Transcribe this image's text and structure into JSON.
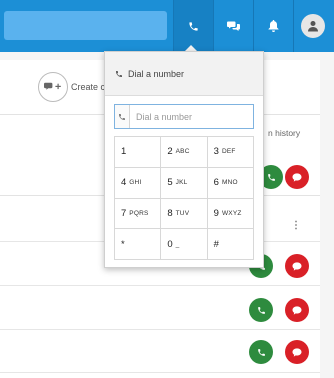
{
  "topbar": {
    "icons": [
      "phone-icon",
      "chat-icon",
      "bell-icon",
      "user-icon"
    ],
    "colors": {
      "bar": "#1c8fd6",
      "active": "#1781c4",
      "search": "#5ab2ee"
    }
  },
  "background_panel": {
    "create_label": "Create c",
    "history_label": "n history",
    "more_symbol": "⋮"
  },
  "dialpad": {
    "title": "Dial a number",
    "input_value": "",
    "input_placeholder": "Dial a number",
    "keys": [
      {
        "digit": "1",
        "letters": ""
      },
      {
        "digit": "2",
        "letters": "ABC"
      },
      {
        "digit": "3",
        "letters": "DEF"
      },
      {
        "digit": "4",
        "letters": "GHI"
      },
      {
        "digit": "5",
        "letters": "JKL"
      },
      {
        "digit": "6",
        "letters": "MNO"
      },
      {
        "digit": "7",
        "letters": "PQRS"
      },
      {
        "digit": "8",
        "letters": "TUV"
      },
      {
        "digit": "9",
        "letters": "WXYZ"
      },
      {
        "digit": "*",
        "letters": ""
      },
      {
        "digit": "0",
        "letters": "_"
      },
      {
        "digit": "#",
        "letters": ""
      }
    ]
  },
  "call_colors": {
    "accept": "#2e8b3e",
    "reject": "#d92027"
  }
}
